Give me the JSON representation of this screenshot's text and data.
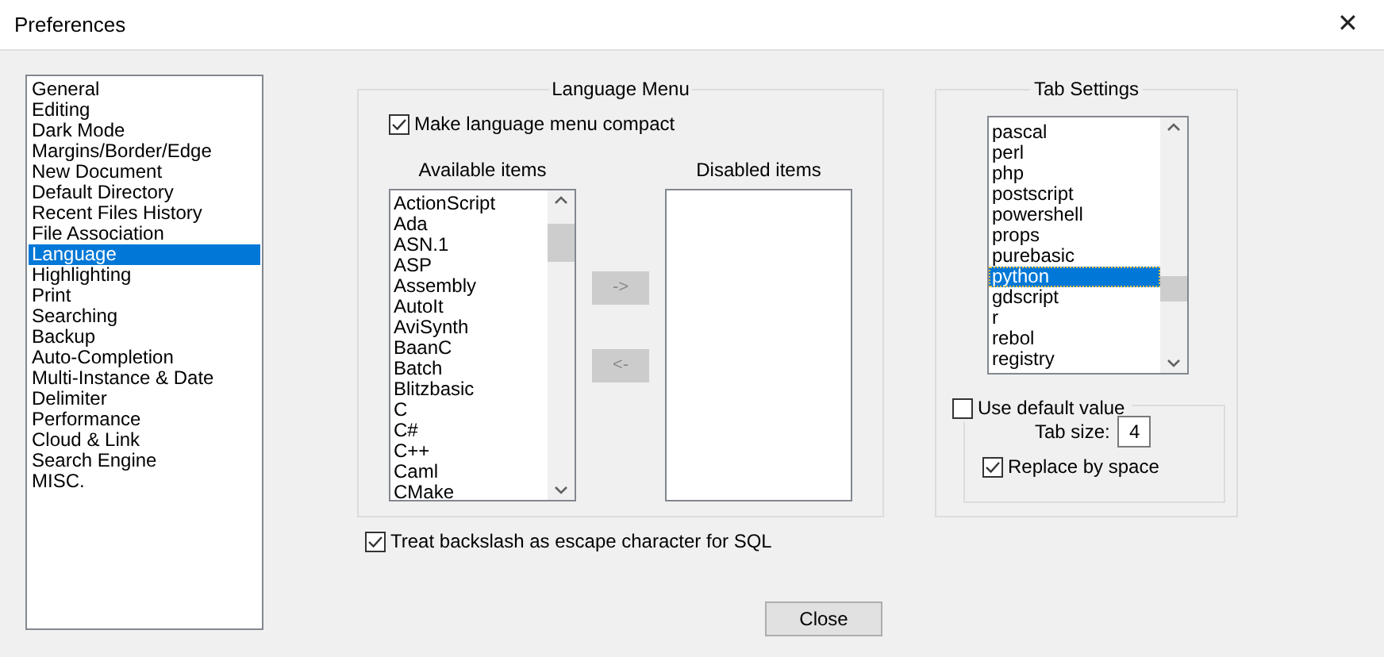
{
  "window": {
    "title": "Preferences",
    "close": "✕"
  },
  "sidebar": {
    "items": [
      {
        "label": "General",
        "selected": false
      },
      {
        "label": "Editing",
        "selected": false
      },
      {
        "label": "Dark Mode",
        "selected": false
      },
      {
        "label": "Margins/Border/Edge",
        "selected": false
      },
      {
        "label": "New Document",
        "selected": false
      },
      {
        "label": "Default Directory",
        "selected": false
      },
      {
        "label": "Recent Files History",
        "selected": false
      },
      {
        "label": "File Association",
        "selected": false
      },
      {
        "label": "Language",
        "selected": true
      },
      {
        "label": "Highlighting",
        "selected": false
      },
      {
        "label": "Print",
        "selected": false
      },
      {
        "label": "Searching",
        "selected": false
      },
      {
        "label": "Backup",
        "selected": false
      },
      {
        "label": "Auto-Completion",
        "selected": false
      },
      {
        "label": "Multi-Instance & Date",
        "selected": false
      },
      {
        "label": "Delimiter",
        "selected": false
      },
      {
        "label": "Performance",
        "selected": false
      },
      {
        "label": "Cloud & Link",
        "selected": false
      },
      {
        "label": "Search Engine",
        "selected": false
      },
      {
        "label": "MISC.",
        "selected": false
      }
    ]
  },
  "language_menu": {
    "title": "Language Menu",
    "compact": {
      "label": "Make language menu compact",
      "checked": true
    },
    "available": {
      "label": "Available items",
      "items": [
        {
          "label": "ActionScript",
          "selected": false
        },
        {
          "label": "Ada",
          "selected": false
        },
        {
          "label": "ASN.1",
          "selected": false
        },
        {
          "label": "ASP",
          "selected": false
        },
        {
          "label": "Assembly",
          "selected": false
        },
        {
          "label": "AutoIt",
          "selected": false
        },
        {
          "label": "AviSynth",
          "selected": false
        },
        {
          "label": "BaanC",
          "selected": false
        },
        {
          "label": "Batch",
          "selected": false
        },
        {
          "label": "Blitzbasic",
          "selected": false
        },
        {
          "label": "C",
          "selected": false
        },
        {
          "label": "C#",
          "selected": false
        },
        {
          "label": "C++",
          "selected": false
        },
        {
          "label": "Caml",
          "selected": false
        },
        {
          "label": "CMake",
          "selected": false
        }
      ]
    },
    "buttons": [
      {
        "label": "->",
        "disabled": true
      },
      {
        "label": "<-",
        "disabled": true
      }
    ],
    "disabled": {
      "label": "Disabled items"
    }
  },
  "sql_backslash": {
    "label": "Treat backslash as escape character for SQL",
    "checked": true
  },
  "tab_settings": {
    "title": "Tab Settings",
    "languages": [
      {
        "label": "pascal",
        "selected": false
      },
      {
        "label": "perl",
        "selected": false
      },
      {
        "label": "php",
        "selected": false
      },
      {
        "label": "postscript",
        "selected": false
      },
      {
        "label": "powershell",
        "selected": false
      },
      {
        "label": "props",
        "selected": false
      },
      {
        "label": "purebasic",
        "selected": false
      },
      {
        "label": "python",
        "selected": true
      },
      {
        "label": "gdscript",
        "selected": false
      },
      {
        "label": "r",
        "selected": false
      },
      {
        "label": "rebol",
        "selected": false
      },
      {
        "label": "registry",
        "selected": false
      }
    ],
    "use_default": {
      "label": "Use default value",
      "checked": false
    },
    "tab_size": {
      "label": "Tab size:",
      "value": "4"
    },
    "replace_by_space": {
      "label": "Replace by space",
      "checked": true
    }
  },
  "close_button": "Close"
}
